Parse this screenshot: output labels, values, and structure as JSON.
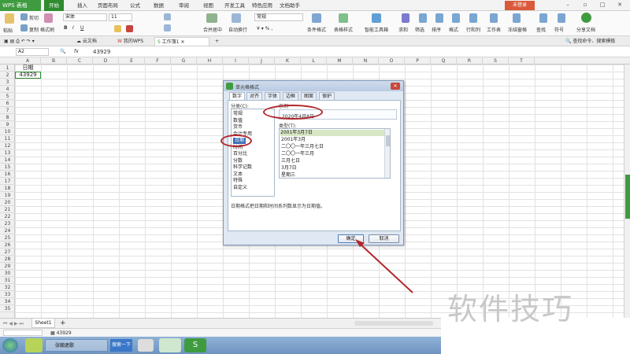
{
  "app": {
    "name": "WPS 表格",
    "login": "未登录"
  },
  "menu": [
    "开始",
    "插入",
    "页面布局",
    "公式",
    "数据",
    "审阅",
    "视图",
    "开发工具",
    "特色应用",
    "文档助手"
  ],
  "ribbon": {
    "paste": "粘贴",
    "cut": "剪切",
    "copy": "复制",
    "format_painter": "格式刷",
    "font_name": "宋体",
    "font_size": "11",
    "merge_center": "合并居中",
    "auto_wrap": "自动换行",
    "number_format": "常规",
    "cond_format": "条件格式",
    "table_style": "表格样式",
    "smart_toolbox": "智能工具箱",
    "sum": "求和",
    "filter": "筛选",
    "sort": "排序",
    "format": "格式",
    "row_col": "行和列",
    "worksheet": "工作表",
    "freeze": "冻结窗格",
    "find": "查找",
    "symbol": "符号",
    "share": "分享文档",
    "find_cmd": "查找命令、搜索模板"
  },
  "doc_tabs": [
    "云文档",
    "我的WPS",
    "工作簿1"
  ],
  "formula_bar": {
    "cell_ref": "A2",
    "fx": "fx",
    "value": "43929"
  },
  "columns": [
    "A",
    "B",
    "C",
    "D",
    "E",
    "F",
    "G",
    "H",
    "I",
    "J",
    "K",
    "L",
    "M",
    "N",
    "O",
    "P",
    "Q",
    "R",
    "S",
    "T"
  ],
  "rows": [
    "1",
    "2",
    "3",
    "4",
    "5",
    "6",
    "7",
    "8",
    "9",
    "10",
    "11",
    "12",
    "13",
    "14",
    "15",
    "16",
    "17",
    "18",
    "19",
    "20",
    "21",
    "22",
    "23",
    "24",
    "25",
    "26",
    "27",
    "28",
    "29",
    "30",
    "31",
    "32",
    "33",
    "34",
    "35"
  ],
  "cells": {
    "a1": "日期",
    "a2": "43929"
  },
  "dialog": {
    "title": "单元格格式",
    "tabs": [
      "数字",
      "对齐",
      "字体",
      "边框",
      "图案",
      "保护"
    ],
    "category_label": "分类(C):",
    "categories": [
      "常规",
      "数值",
      "货币",
      "会计专用",
      "日期",
      "时间",
      "百分比",
      "分数",
      "科学记数",
      "文本",
      "特殊",
      "自定义"
    ],
    "selected_category": "日期",
    "sample_label": "示例",
    "sample_value": "2020年4月8日",
    "type_label": "类型(T):",
    "types": [
      "2001年3月7日",
      "2001年3月",
      "二〇〇一年三月七日",
      "二〇〇一年三月",
      "三月七日",
      "3月7日",
      "星期三"
    ],
    "description": "日期格式把日期和时间系列数显示为日期值。",
    "ok": "确定",
    "cancel": "取消"
  },
  "sheet_tabs": [
    "Sheet1"
  ],
  "status": {
    "value": "43929"
  },
  "taskbar": {
    "browser": "张翰遮歌",
    "search": "搜索一下"
  },
  "watermark": "软件技巧",
  "colors": {
    "accent": "#2e8b2e",
    "annotation": "#b3262a"
  }
}
